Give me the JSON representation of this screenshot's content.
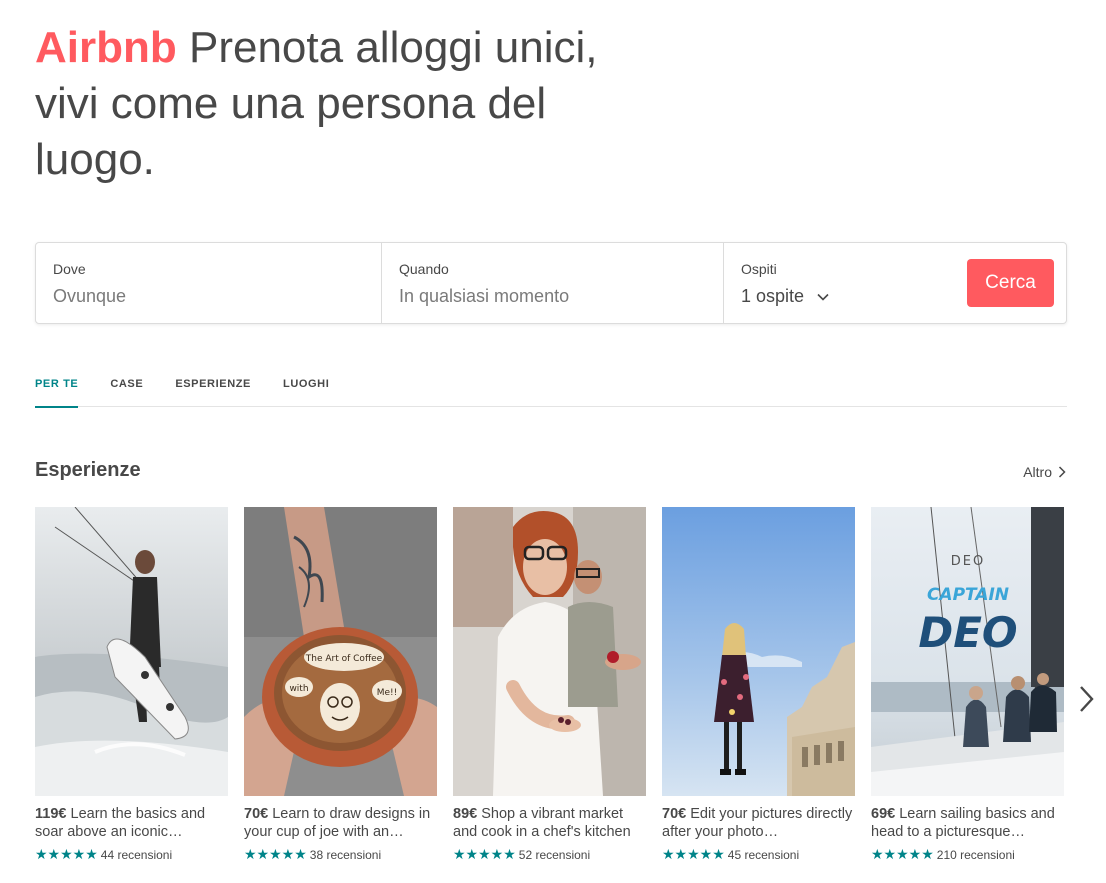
{
  "hero": {
    "brand": "Airbnb",
    "tagline": " Prenota alloggi unici, vivi come una persona del luogo."
  },
  "search": {
    "where_label": "Dove",
    "where_placeholder": "Ovunque",
    "when_label": "Quando",
    "when_placeholder": "In qualsiasi momento",
    "guests_label": "Ospiti",
    "guests_value": "1 ospite",
    "search_button": "Cerca"
  },
  "tabs": [
    {
      "label": "PER TE",
      "active": true
    },
    {
      "label": "CASE",
      "active": false
    },
    {
      "label": "ESPERIENZE",
      "active": false
    },
    {
      "label": "LUOGHI",
      "active": false
    }
  ],
  "section": {
    "title": "Esperienze",
    "more_label": "Altro"
  },
  "cards": [
    {
      "price": "119€",
      "text": "Learn the basics and soar above an iconic…",
      "stars": "★★★★★",
      "reviews": "44 recensioni"
    },
    {
      "price": "70€",
      "text": "Learn to draw designs in your cup of joe with an…",
      "stars": "★★★★★",
      "reviews": "38 recensioni"
    },
    {
      "price": "89€",
      "text": "Shop a vibrant market and cook in a chef's kitchen",
      "stars": "★★★★★",
      "reviews": "52 recensioni"
    },
    {
      "price": "70€",
      "text": "Edit your pictures directly after your photo…",
      "stars": "★★★★★",
      "reviews": "45 recensioni"
    },
    {
      "price": "69€",
      "text": "Learn sailing basics and head to a picturesque…",
      "stars": "★★★★★",
      "reviews": "210 recensioni"
    }
  ],
  "card_image_texts": {
    "coffee_line1": "The Art of Coffee",
    "coffee_with": "with",
    "coffee_me": "Me!!",
    "deo_small": "DEO",
    "deo_captain": "CAPTAIN",
    "deo_big": "DEO"
  },
  "colors": {
    "brand": "#FF5A5F",
    "accent": "#008489",
    "text": "#484848"
  },
  "icons": {
    "guests_dropdown": "chevron-down-icon",
    "more": "chevron-right-icon",
    "carousel_next": "chevron-right-icon",
    "rating": "star-icon"
  }
}
